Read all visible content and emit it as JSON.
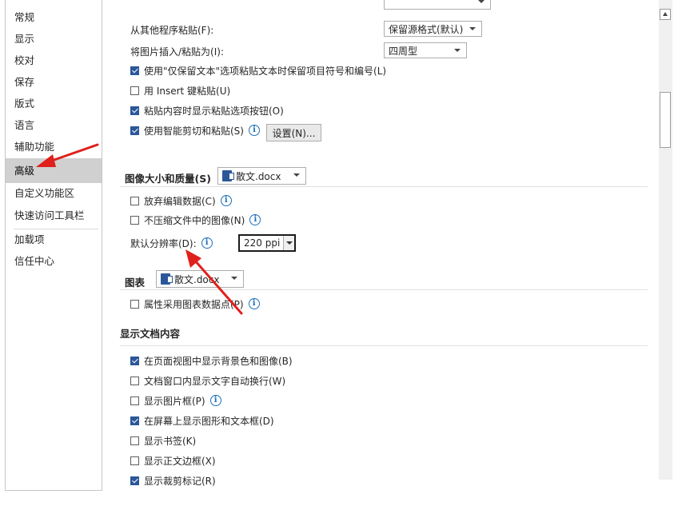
{
  "sidebar": {
    "items": [
      {
        "label": "常规"
      },
      {
        "label": "显示"
      },
      {
        "label": "校对"
      },
      {
        "label": "保存"
      },
      {
        "label": "版式"
      },
      {
        "label": "语言"
      },
      {
        "label": "辅助功能"
      },
      {
        "label": "高级",
        "selected": true
      },
      {
        "label": "自定义功能区"
      },
      {
        "label": "快速访问工具栏"
      },
      {
        "label": "加载项"
      },
      {
        "label": "信任中心"
      }
    ]
  },
  "paste": {
    "other_program_label": "从其他程序粘贴(F):",
    "other_program_value": "保留源格式(默认)",
    "insert_picture_label": "将图片插入/粘贴为(I):",
    "insert_picture_value": "四周型",
    "keep_bullets": {
      "label": "使用\"仅保留文本\"选项粘贴文本时保留项目符号和编号(L)",
      "checked": true
    },
    "insert_key": {
      "label": "用 Insert 键粘贴(U)",
      "checked": false
    },
    "show_paste_btn": {
      "label": "粘贴内容时显示粘贴选项按钮(O)",
      "checked": true
    },
    "smart_cut": {
      "label": "使用智能剪切和粘贴(S)",
      "checked": true
    },
    "settings_button": "设置(N)..."
  },
  "image_quality": {
    "title": "图像大小和质量(S)",
    "doc_value": "散文.docx",
    "discard_editing": {
      "label": "放弃编辑数据(C)",
      "checked": false
    },
    "no_compress": {
      "label": "不压缩文件中的图像(N)",
      "checked": false
    },
    "default_res_label": "默认分辨率(D):",
    "default_res_value": "220 ppi"
  },
  "chart": {
    "title": "图表",
    "doc_value": "散文.docx",
    "properties_follow": {
      "label": "属性采用图表数据点(P)",
      "checked": false
    }
  },
  "display_content": {
    "title": "显示文档内容",
    "items": [
      {
        "label": "在页面视图中显示背景色和图像(B)",
        "checked": true
      },
      {
        "label": "文档窗口内显示文字自动换行(W)",
        "checked": false
      },
      {
        "label": "显示图片框(P)",
        "checked": false,
        "info": true
      },
      {
        "label": "在屏幕上显示图形和文本框(D)",
        "checked": true
      },
      {
        "label": "显示书签(K)",
        "checked": false
      },
      {
        "label": "显示正文边框(X)",
        "checked": false
      },
      {
        "label": "显示裁剪标记(R)",
        "checked": true
      }
    ]
  },
  "icons": {
    "info": "info-icon",
    "doc": "word-document-icon",
    "arrow": "red-annotation-arrow"
  },
  "colors": {
    "accent": "#2b579a",
    "annotation": "#e0201c",
    "info": "#1d6fb8"
  }
}
